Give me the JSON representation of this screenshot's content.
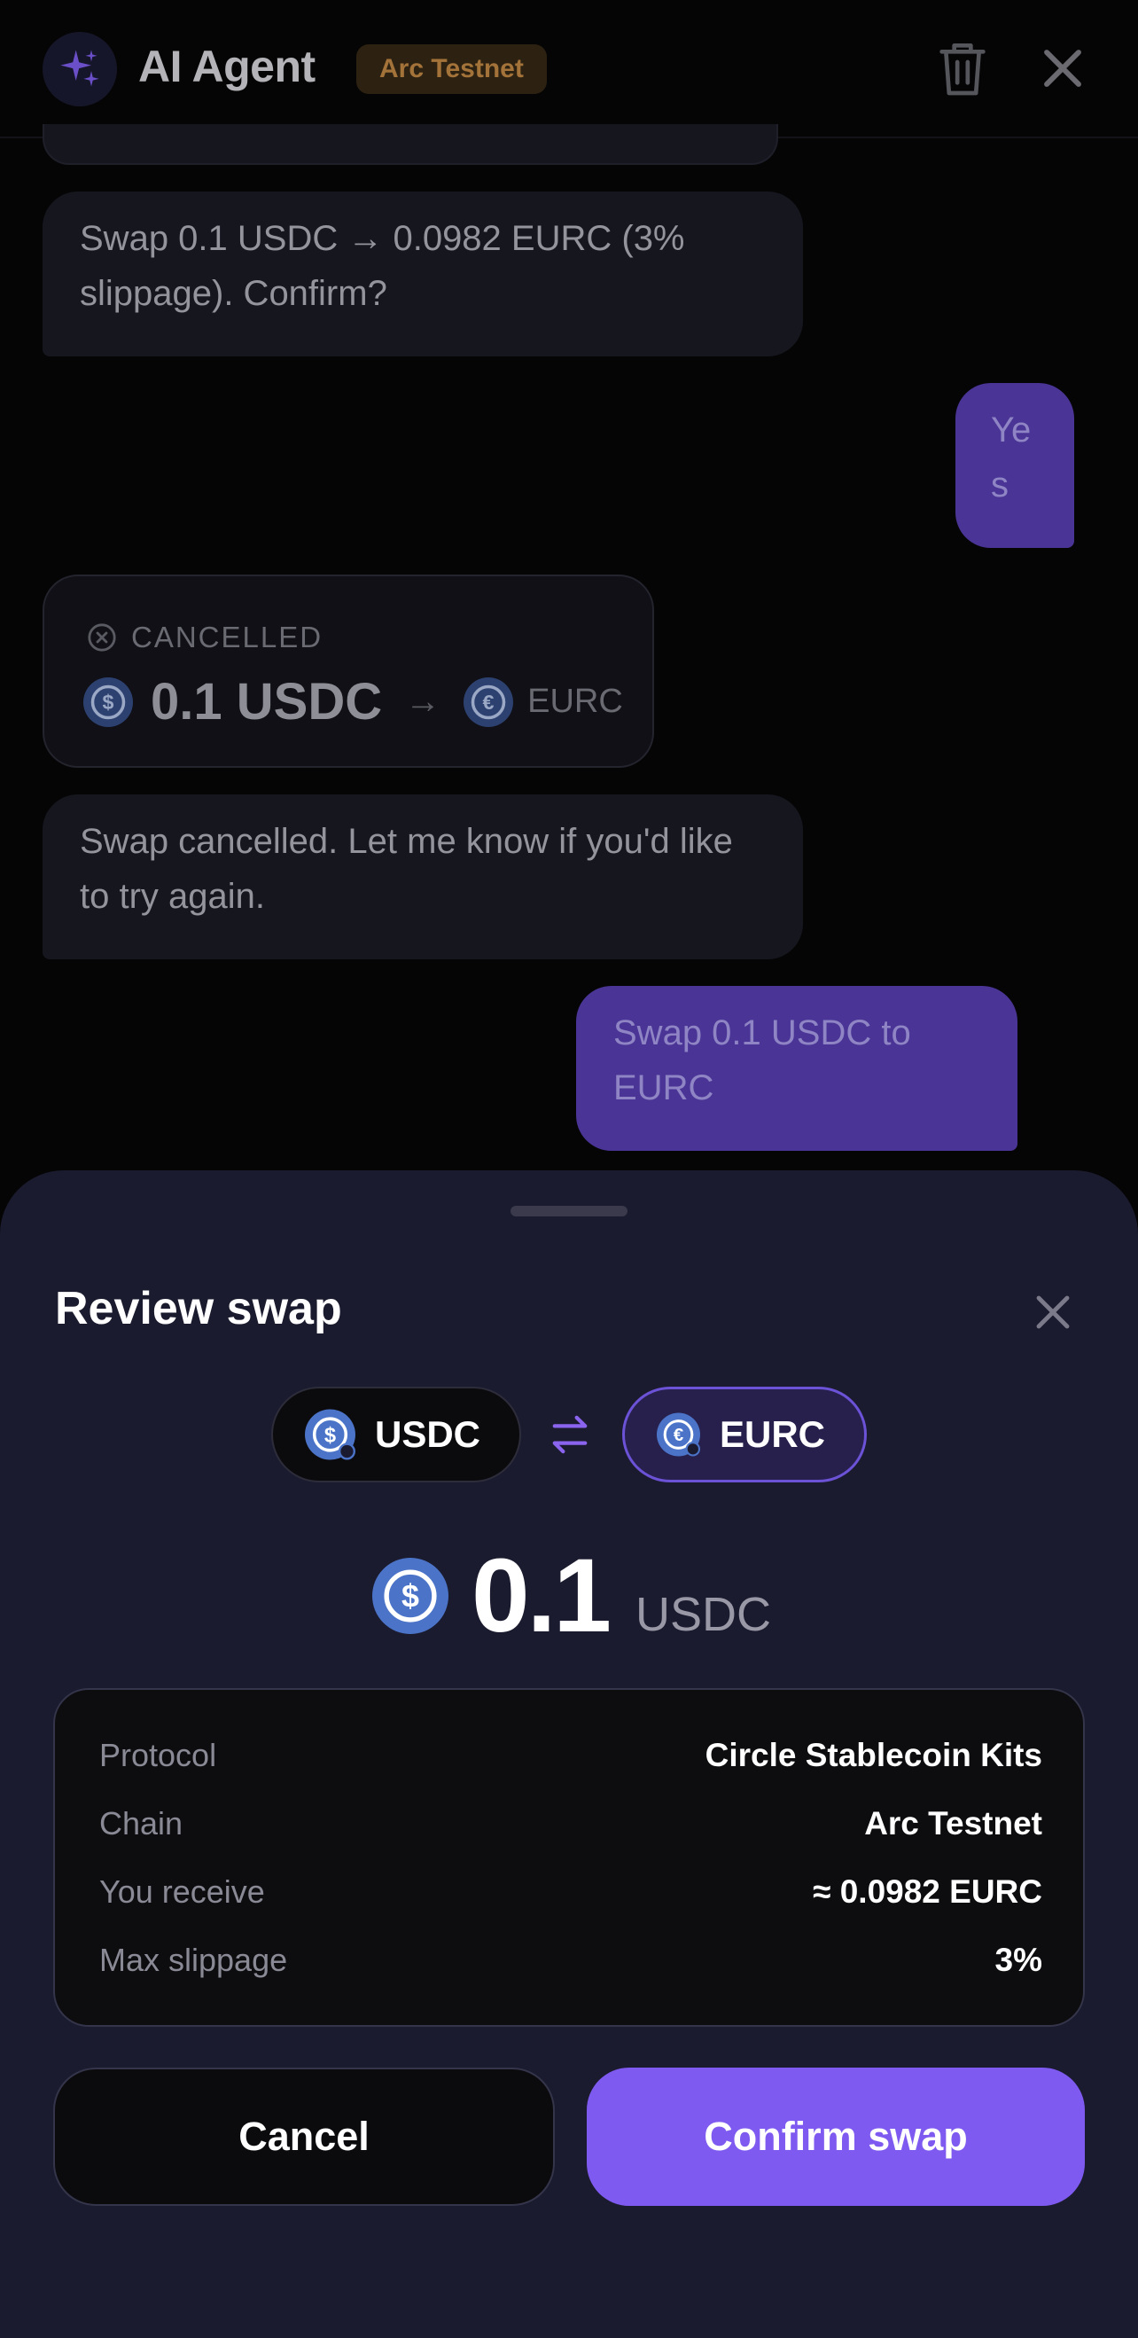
{
  "header": {
    "title": "AI Agent",
    "network_badge": "Arc Testnet",
    "icons": {
      "avatar": "sparkles-icon",
      "trash": "trash-icon",
      "close": "close-icon"
    }
  },
  "chat": {
    "messages": [
      {
        "role": "agent",
        "text": "Swap 0.1 USDC → 0.0982 EURC (3% slippage). Confirm?"
      },
      {
        "role": "user",
        "text": "Yes"
      },
      {
        "role": "agent",
        "text": "Swap cancelled. Let me know if you'd like to try again."
      },
      {
        "role": "user",
        "text": "Swap 0.1 USDC to EURC"
      }
    ],
    "cancelled_card": {
      "status": "CANCELLED",
      "amount": "0.1 USDC",
      "arrow": "→",
      "to_token": "EURC"
    }
  },
  "sheet": {
    "title": "Review swap",
    "from_token": "USDC",
    "to_token": "EURC",
    "amount": "0.1",
    "amount_unit": "USDC",
    "details": [
      {
        "label": "Protocol",
        "value": "Circle Stablecoin Kits"
      },
      {
        "label": "Chain",
        "value": "Arc Testnet"
      },
      {
        "label": "You receive",
        "value": "≈ 0.0982 EURC"
      },
      {
        "label": "Max slippage",
        "value": "3%"
      }
    ],
    "cancel_label": "Cancel",
    "confirm_label": "Confirm swap"
  },
  "colors": {
    "accent": "#7e5af0",
    "sheet_bg": "#1b1b2f",
    "badge_text": "#a4733a",
    "usdc_blue": "#4b74c8"
  }
}
